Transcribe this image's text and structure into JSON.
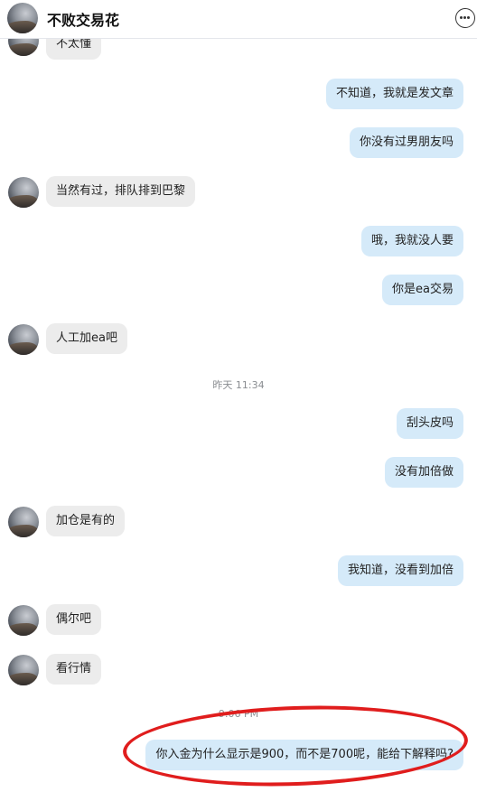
{
  "header": {
    "title": "不败交易花",
    "more_icon": "more-horizontal-icon"
  },
  "messages": {
    "m0": "不太懂",
    "m1": "不知道，我就是发文章",
    "m2": "你没有过男朋友吗",
    "m3": "当然有过，排队排到巴黎",
    "m4": "哦，我就没人要",
    "m5": "你是ea交易",
    "m6": "人工加ea吧",
    "m7": "刮头皮吗",
    "m8": "没有加倍做",
    "m9": "加仓是有的",
    "m10": "我知道，没看到加倍",
    "m11": "偶尔吧",
    "m12": "看行情",
    "m13": "你入金为什么显示是900，而不是700呢，能给下解释吗?"
  },
  "timestamps": {
    "t1": "昨天 11:34",
    "t2": "9:06 PM"
  },
  "colors": {
    "incoming_bubble": "#ececec",
    "outgoing_bubble": "#d5eaf9",
    "annotation_red": "#e01d1d"
  }
}
